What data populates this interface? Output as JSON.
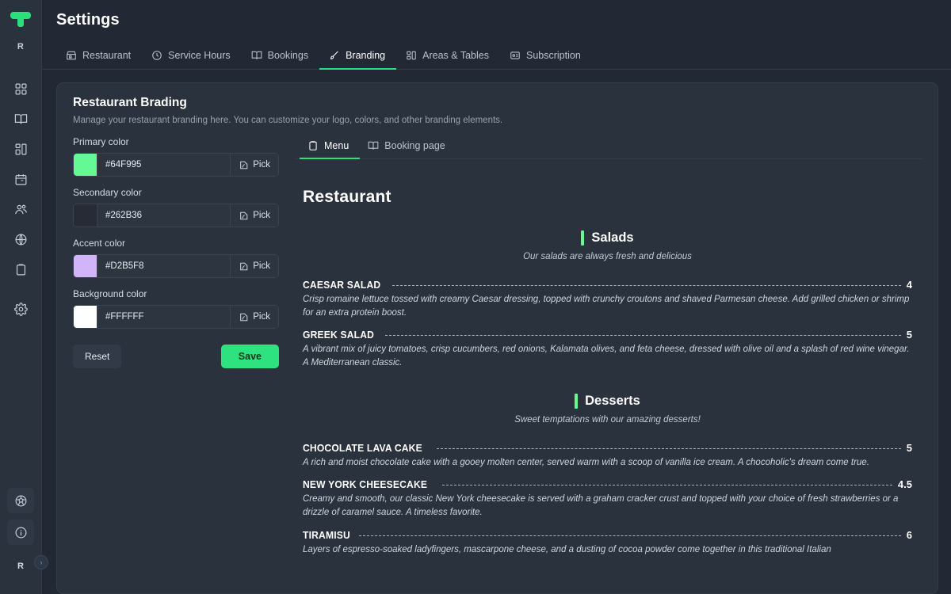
{
  "app": {
    "logo_icon": "t-logo-icon",
    "top_avatar_initial": "R",
    "bottom_avatar_initial": "R",
    "collapse_icon": "chevron-right-circle-icon",
    "accent_green": "#29E07B",
    "card_bg": "#2a323d",
    "page_bg": "#222935"
  },
  "sidebar": {
    "items": [
      {
        "icon": "grid-dashboard-icon",
        "name": "sidebar-item-dashboard"
      },
      {
        "icon": "book-open-icon",
        "name": "sidebar-item-menu"
      },
      {
        "icon": "layout-panels-icon",
        "name": "sidebar-item-layout"
      },
      {
        "icon": "calendar-icon",
        "name": "sidebar-item-calendar"
      },
      {
        "icon": "users-icon",
        "name": "sidebar-item-customers"
      },
      {
        "icon": "globe-icon",
        "name": "sidebar-item-website"
      },
      {
        "icon": "clipboard-icon",
        "name": "sidebar-item-orders"
      },
      {
        "icon": "gear-icon",
        "name": "sidebar-item-settings"
      }
    ],
    "bottom_items": [
      {
        "icon": "support-ball-icon",
        "name": "sidebar-item-support"
      },
      {
        "icon": "info-icon",
        "name": "sidebar-item-info"
      }
    ]
  },
  "header": {
    "title": "Settings"
  },
  "tabs": [
    {
      "label": "Restaurant",
      "icon": "store-icon",
      "active": false
    },
    {
      "label": "Service Hours",
      "icon": "clock-icon",
      "active": false
    },
    {
      "label": "Bookings",
      "icon": "book-open-icon",
      "active": false
    },
    {
      "label": "Branding",
      "icon": "brush-icon",
      "active": true
    },
    {
      "label": "Areas & Tables",
      "icon": "tables-icon",
      "active": false
    },
    {
      "label": "Subscription",
      "icon": "card-icon",
      "active": false
    }
  ],
  "card": {
    "title": "Restaurant Brading",
    "subtitle": "Manage your restaurant branding here. You can customize your logo, colors, and other branding elements."
  },
  "color_fields": [
    {
      "label": "Primary color",
      "value": "#64F995",
      "swatch": "#64F995",
      "pick_label": "Pick",
      "pick_icon": "color-picker-icon"
    },
    {
      "label": "Secondary color",
      "value": "#262B36",
      "swatch": "#262B36",
      "pick_label": "Pick",
      "pick_icon": "color-picker-icon"
    },
    {
      "label": "Accent color",
      "value": "#D2B5F8",
      "swatch": "#D2B5F8",
      "pick_label": "Pick",
      "pick_icon": "color-picker-icon"
    },
    {
      "label": "Background color",
      "value": "#FFFFFF",
      "swatch": "#FFFFFF",
      "pick_label": "Pick",
      "pick_icon": "color-picker-icon"
    }
  ],
  "buttons": {
    "reset_label": "Reset",
    "save_label": "Save"
  },
  "preview_tabs": [
    {
      "label": "Menu",
      "icon": "clipboard-icon",
      "active": true
    },
    {
      "label": "Booking page",
      "icon": "book-open-icon",
      "active": false
    }
  ],
  "menu": {
    "restaurant_name": "Restaurant",
    "sections": [
      {
        "name": "Salads",
        "subtitle": "Our salads are always fresh and delicious",
        "items": [
          {
            "name": "CAESAR SALAD",
            "price": "4",
            "description": "Crisp romaine lettuce tossed with creamy Caesar dressing, topped with crunchy croutons and shaved Parmesan cheese. Add grilled chicken or shrimp for an extra protein boost."
          },
          {
            "name": "GREEK SALAD",
            "price": "5",
            "description": "A vibrant mix of juicy tomatoes, crisp cucumbers, red onions, Kalamata olives, and feta cheese, dressed with olive oil and a splash of red wine vinegar. A Mediterranean classic."
          }
        ]
      },
      {
        "name": "Desserts",
        "subtitle": "Sweet temptations with our amazing desserts!",
        "items": [
          {
            "name": "CHOCOLATE LAVA CAKE",
            "price": "5",
            "description": "A rich and moist chocolate cake with a gooey molten center, served warm with a scoop of vanilla ice cream. A chocoholic's dream come true."
          },
          {
            "name": "NEW YORK CHEESECAKE",
            "price": "4.5",
            "description": "Creamy and smooth, our classic New York cheesecake is served with a graham cracker crust and topped with your choice of fresh strawberries or a drizzle of caramel sauce. A timeless favorite."
          },
          {
            "name": "TIRAMISU",
            "price": "6",
            "description": "Layers of espresso-soaked ladyfingers, mascarpone cheese, and a dusting of cocoa powder come together in this traditional Italian"
          }
        ]
      }
    ]
  }
}
